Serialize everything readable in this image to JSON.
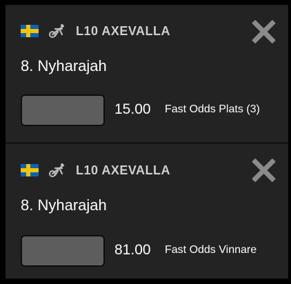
{
  "bets": [
    {
      "race": "L10 AXEVALLA",
      "horse": "8. Nyharajah",
      "stake_value": "",
      "odds": "15.00",
      "bet_type": "Fast Odds Plats (3)",
      "flag": "sweden-flag-icon",
      "race_icon": "sulky-icon"
    },
    {
      "race": "L10 AXEVALLA",
      "horse": "8. Nyharajah",
      "stake_value": "",
      "odds": "81.00",
      "bet_type": "Fast Odds Vinnare",
      "flag": "sweden-flag-icon",
      "race_icon": "sulky-icon"
    }
  ],
  "colors": {
    "background": "#000000",
    "card": "#232323",
    "race_text": "#cfcfcf",
    "close_icon": "#8b8b8b",
    "stake_field": "#5d5d5d",
    "flag_blue": "#0b63b5",
    "flag_yellow": "#f4c400"
  }
}
